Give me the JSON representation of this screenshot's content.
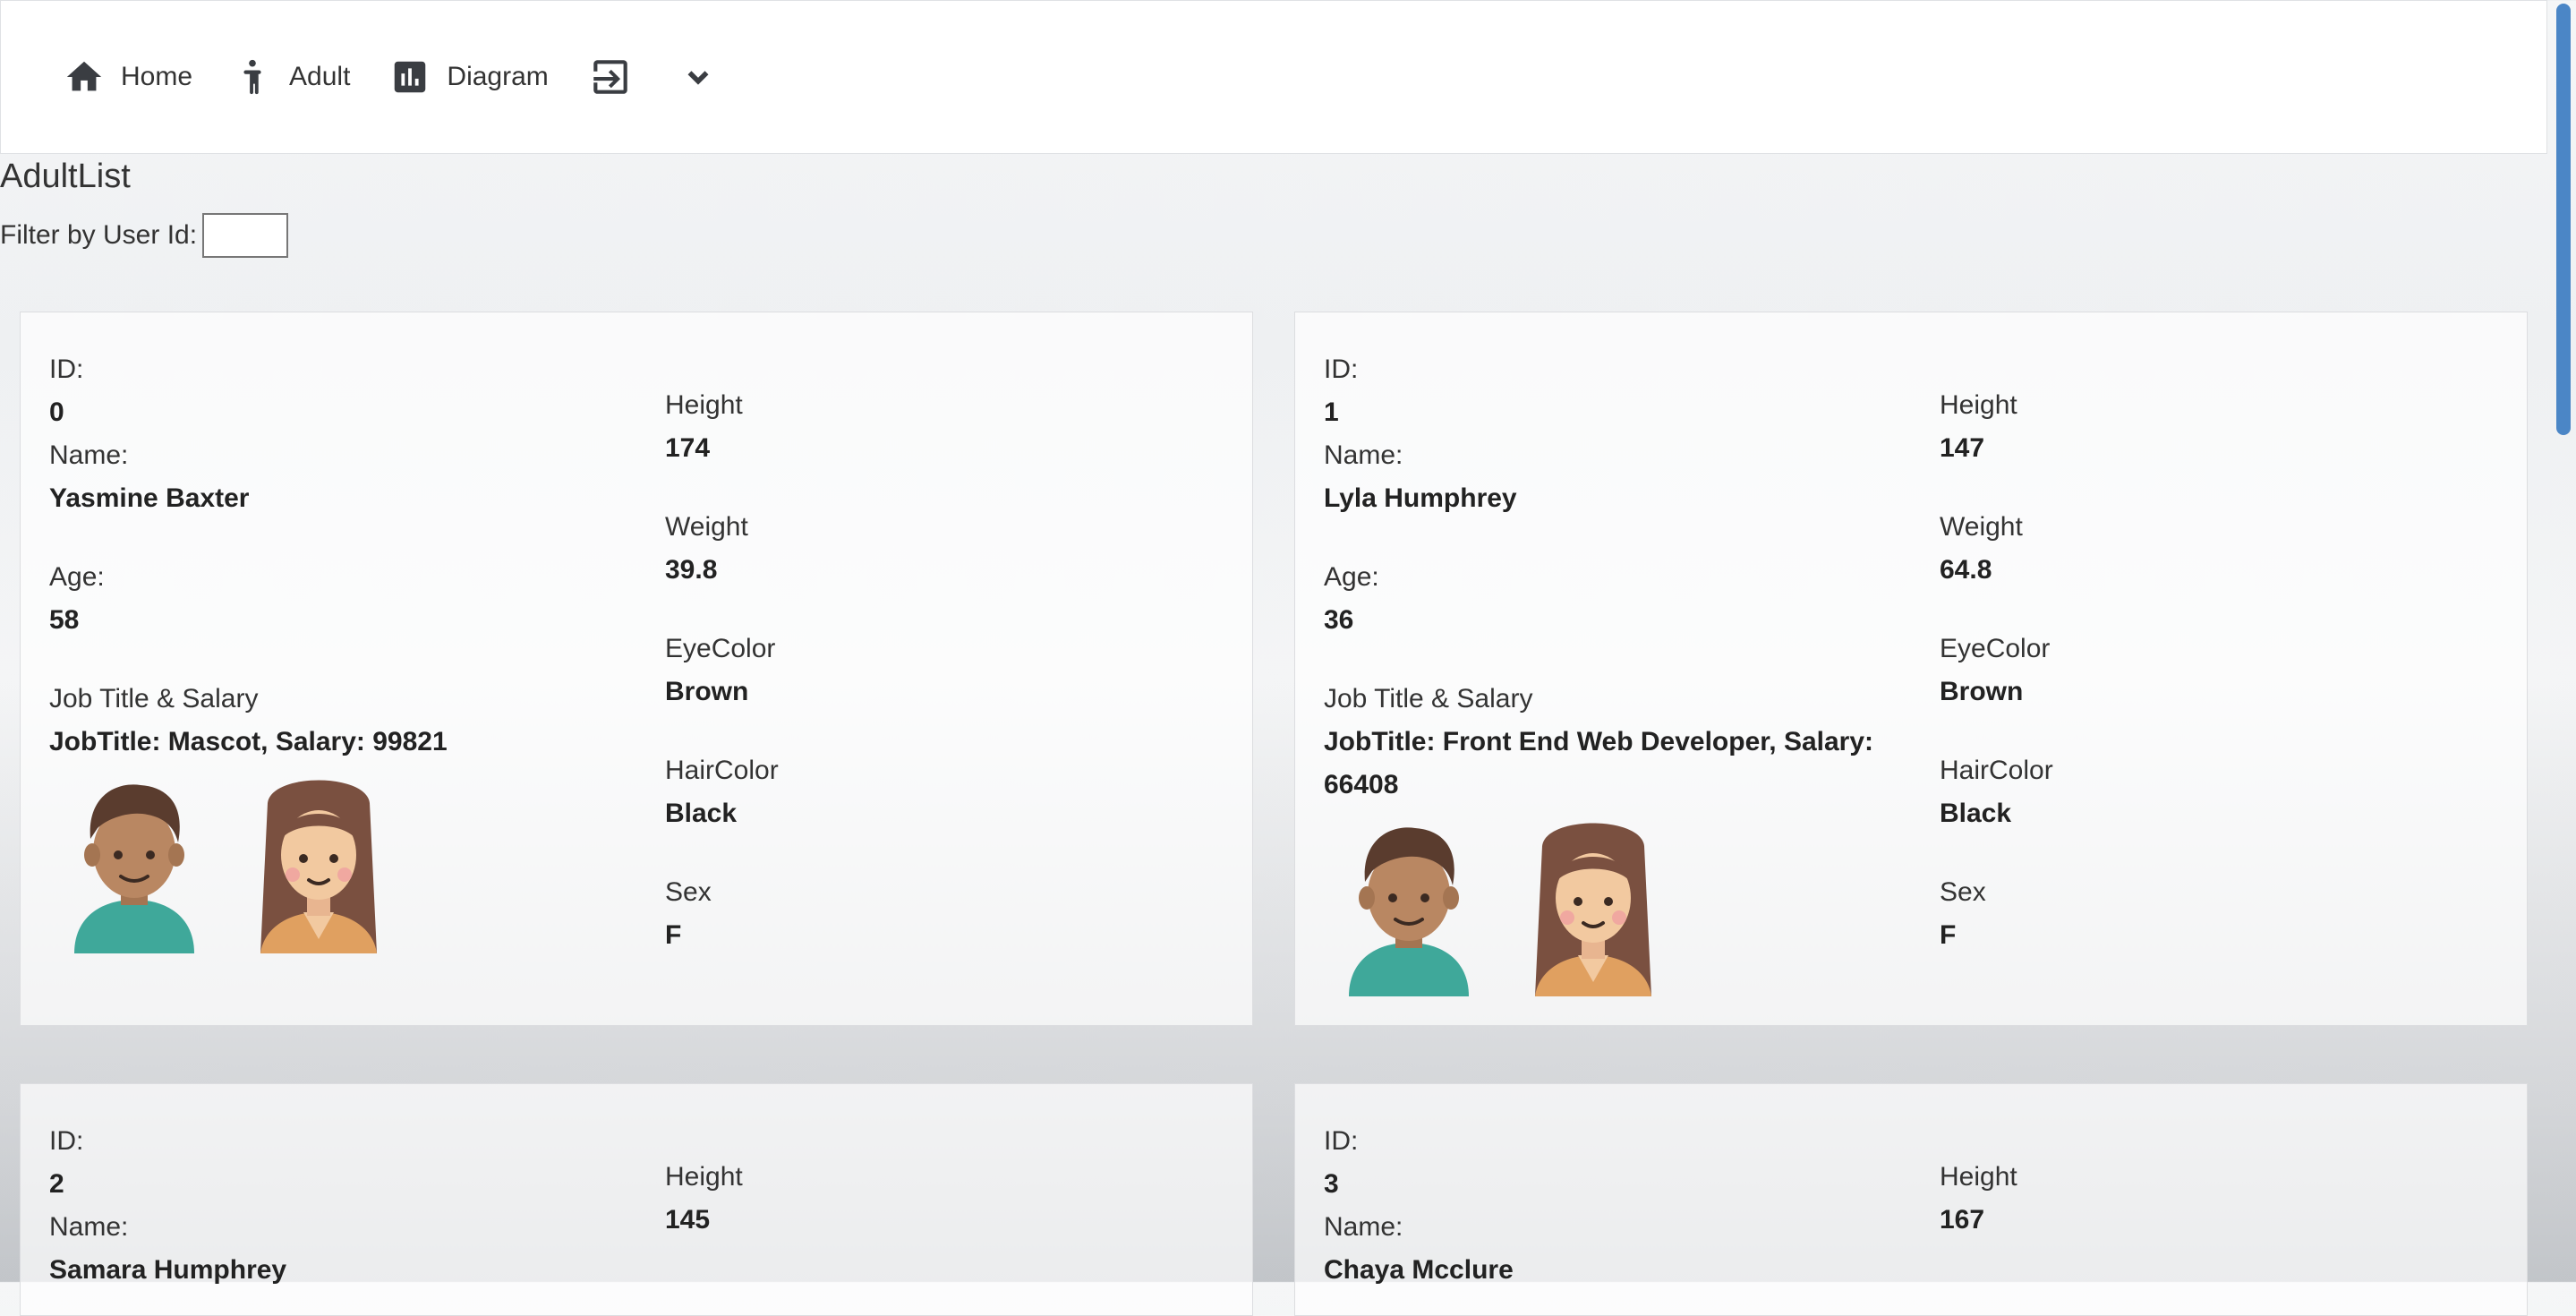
{
  "nav": {
    "items": [
      {
        "label": "Home",
        "icon": "home-icon"
      },
      {
        "label": "Adult",
        "icon": "person-icon"
      },
      {
        "label": "Diagram",
        "icon": "chart-icon"
      }
    ],
    "logout_icon": "logout-icon",
    "dropdown_icon": "chevron-down-icon"
  },
  "page": {
    "title": "AdultList",
    "filter_label": "Filter by User Id:",
    "filter_value": ""
  },
  "labels": {
    "id": "ID:",
    "name": "Name:",
    "age": "Age:",
    "job": "Job Title & Salary",
    "height": "Height",
    "weight": "Weight",
    "eye": "EyeColor",
    "hair": "HairColor",
    "sex": "Sex"
  },
  "adults": [
    {
      "id": "0",
      "name": "Yasmine Baxter",
      "age": "58",
      "job": "JobTitle: Mascot, Salary: 99821",
      "height": "174",
      "weight": "39.8",
      "eye": "Brown",
      "hair": "Black",
      "sex": "F"
    },
    {
      "id": "1",
      "name": "Lyla Humphrey",
      "age": "36",
      "job": "JobTitle: Front End Web Developer, Salary: 66408",
      "height": "147",
      "weight": "64.8",
      "eye": "Brown",
      "hair": "Black",
      "sex": "F"
    },
    {
      "id": "2",
      "name": "Samara Humphrey",
      "height": "145"
    },
    {
      "id": "3",
      "name": "Chaya Mcclure",
      "height": "167"
    }
  ],
  "colors": {
    "scrollbar": "#4b86c6",
    "nav_icon": "#3a3d42"
  }
}
